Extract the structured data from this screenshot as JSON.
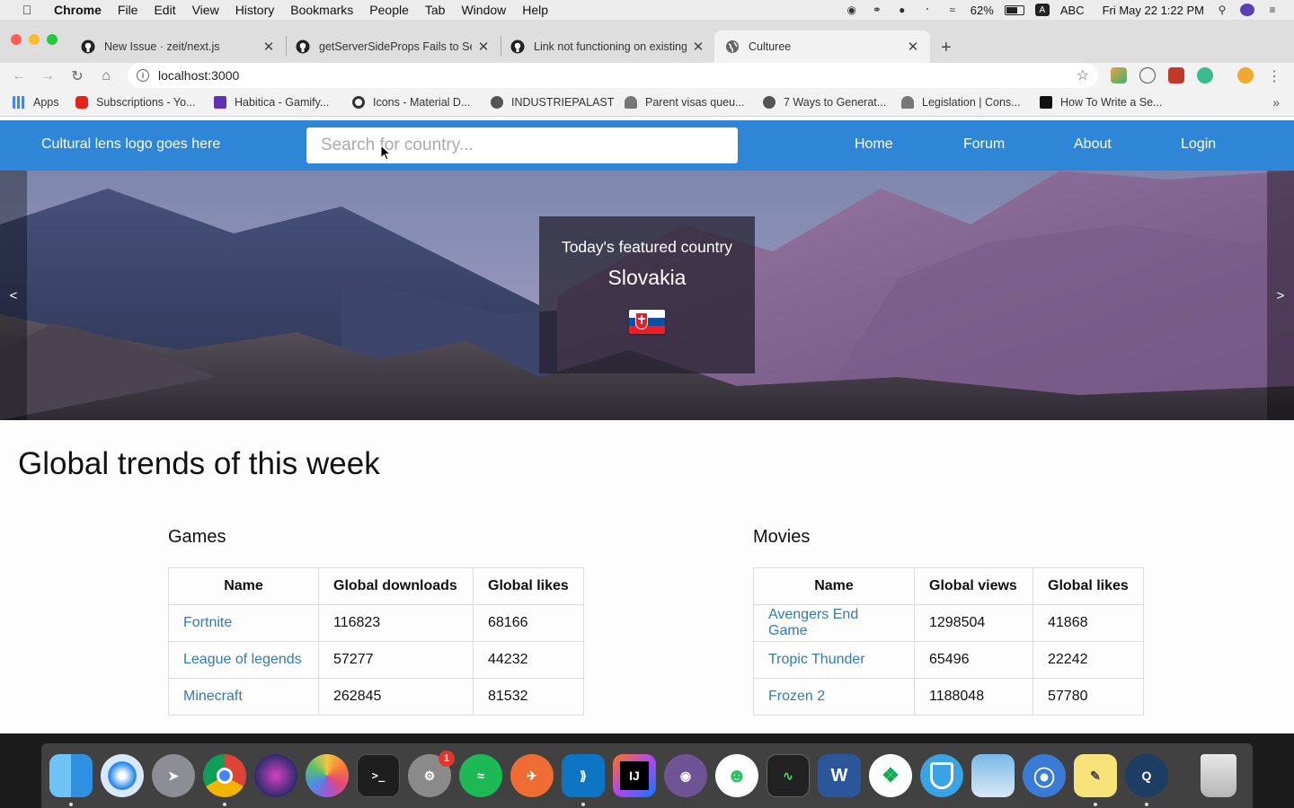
{
  "menubar": {
    "app": "Chrome",
    "items": [
      "File",
      "Edit",
      "View",
      "History",
      "Bookmarks",
      "People",
      "Tab",
      "Window",
      "Help"
    ],
    "battery": "62%",
    "input_source": "ABC",
    "datetime": "Fri May 22  1:22 PM"
  },
  "tabs": [
    {
      "title": "New Issue · zeit/next.js",
      "icon": "github-icon"
    },
    {
      "title": "getServerSideProps Fails to Se",
      "icon": "github-icon"
    },
    {
      "title": "Link not functioning on existing",
      "icon": "github-icon"
    },
    {
      "title": "Culturee",
      "icon": "globe-icon",
      "active": true
    }
  ],
  "omnibox": {
    "url": "localhost:3000"
  },
  "bookmarks": [
    {
      "label": "Apps",
      "color": "#4285f4"
    },
    {
      "label": "Subscriptions - Yo...",
      "color": "#e62117"
    },
    {
      "label": "Habitica - Gamify...",
      "color": "#6133b4"
    },
    {
      "label": "Icons - Material D...",
      "color": "#333333"
    },
    {
      "label": "INDUSTRIEPALAST",
      "color": "#444444"
    },
    {
      "label": "Parent visas queu...",
      "color": "#555555"
    },
    {
      "label": "7 Ways to Generat...",
      "color": "#444444"
    },
    {
      "label": "Legislation | Cons...",
      "color": "#555555"
    },
    {
      "label": "How To Write a Se...",
      "color": "#111111"
    }
  ],
  "site": {
    "logo_text": "Cultural lens logo goes here",
    "search_placeholder": "Search for country...",
    "nav": [
      "Home",
      "Forum",
      "About",
      "Login"
    ],
    "accent_color": "#2f86d7"
  },
  "hero": {
    "prev": "<",
    "next": ">",
    "featured_label": "Today's featured country",
    "country": "Slovakia",
    "flag": "slovakia-flag"
  },
  "trends": {
    "title": "Global trends of this week",
    "games": {
      "title": "Games",
      "headers": [
        "Name",
        "Global downloads",
        "Global likes"
      ],
      "rows": [
        [
          "Fortnite",
          "116823",
          "68166"
        ],
        [
          "League of legends",
          "57277",
          "44232"
        ],
        [
          "Minecraft",
          "262845",
          "81532"
        ]
      ]
    },
    "movies": {
      "title": "Movies",
      "headers": [
        "Name",
        "Global views",
        "Global likes"
      ],
      "rows": [
        [
          "Avengers End Game",
          "1298504",
          "41868"
        ],
        [
          "Tropic Thunder",
          "65496",
          "22242"
        ],
        [
          "Frozen 2",
          "1188048",
          "57780"
        ]
      ]
    }
  },
  "dock": {
    "apps": [
      "finder",
      "safari",
      "launchpad",
      "chrome",
      "siri",
      "photos",
      "terminal",
      "system-preferences",
      "spotify",
      "postman",
      "vscode",
      "intellij",
      "github-desktop",
      "evernote",
      "activity-monitor",
      "word",
      "mongodb-compass",
      "shield-app",
      "preview",
      "sourcetree-app",
      "stickies",
      "quicktime",
      "trash"
    ],
    "prefs_badge": "1",
    "intellij_label": "IJ",
    "word_label": "W"
  }
}
